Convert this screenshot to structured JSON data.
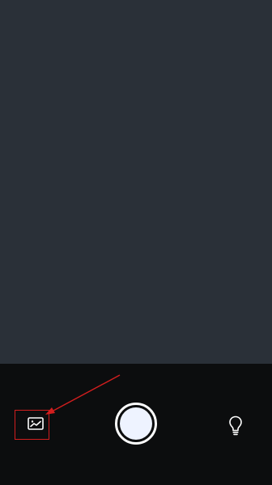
{
  "app": {
    "screen": "camera"
  },
  "colors": {
    "viewfinder": "#2a3038",
    "controls_bar": "#0c0d0e",
    "shutter_fill": "#eef3ff",
    "shutter_ring": "#ffffff",
    "annotation": "#d21e1e"
  },
  "icons": {
    "gallery": "gallery-icon",
    "shutter": "shutter-button",
    "flash": "lightbulb-icon"
  }
}
